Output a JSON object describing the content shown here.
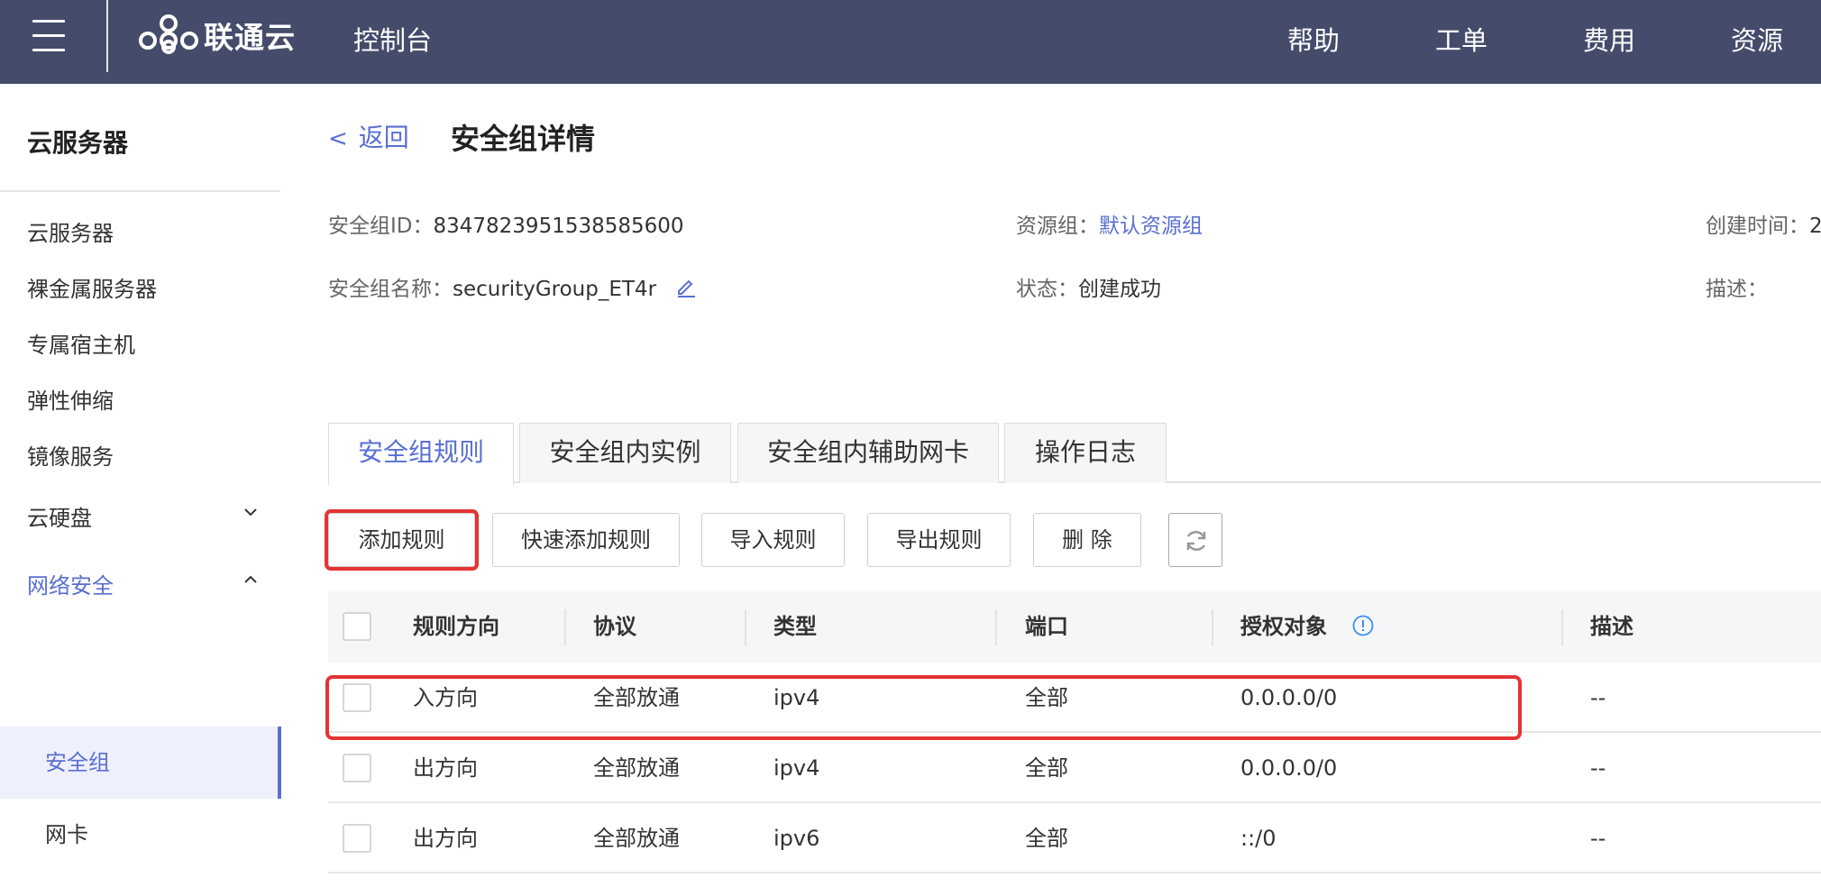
{
  "topbar": {
    "brand": "联通云",
    "console": "控制台",
    "nav": [
      "帮助",
      "工单",
      "费用",
      "资源"
    ]
  },
  "sidebar": {
    "title": "云服务器",
    "items": [
      "云服务器",
      "裸金属服务器",
      "专属宿主机",
      "弹性伸缩",
      "镜像服务",
      "云硬盘",
      "网络安全"
    ],
    "sub_items": [
      "安全组",
      "网卡"
    ]
  },
  "header": {
    "back": "返回",
    "title": "安全组详情"
  },
  "info": {
    "id_label": "安全组ID：",
    "id_value": "8347823951538585600",
    "name_label": "安全组名称：",
    "name_value": "securityGroup_ET4r",
    "resource_group_label": "资源组：",
    "resource_group_value": "默认资源组",
    "status_label": "状态：",
    "status_value": "创建成功",
    "created_label": "创建时间：",
    "created_value": "2",
    "desc_label": "描述："
  },
  "tabs": [
    "安全组规则",
    "安全组内实例",
    "安全组内辅助网卡",
    "操作日志"
  ],
  "toolbar": {
    "add": "添加规则",
    "quick_add": "快速添加规则",
    "import": "导入规则",
    "export": "导出规则",
    "delete": "删 除"
  },
  "table": {
    "headers": [
      "规则方向",
      "协议",
      "类型",
      "端口",
      "授权对象",
      "描述"
    ],
    "rows": [
      [
        "入方向",
        "全部放通",
        "ipv4",
        "全部",
        "0.0.0.0/0",
        "--"
      ],
      [
        "出方向",
        "全部放通",
        "ipv4",
        "全部",
        "0.0.0.0/0",
        "--"
      ],
      [
        "出方向",
        "全部放通",
        "ipv6",
        "全部",
        "::/0",
        "--"
      ]
    ]
  },
  "colors": {
    "topbar": "#454c6b",
    "accent": "#5a6fd1",
    "highlight": "#e53333"
  }
}
